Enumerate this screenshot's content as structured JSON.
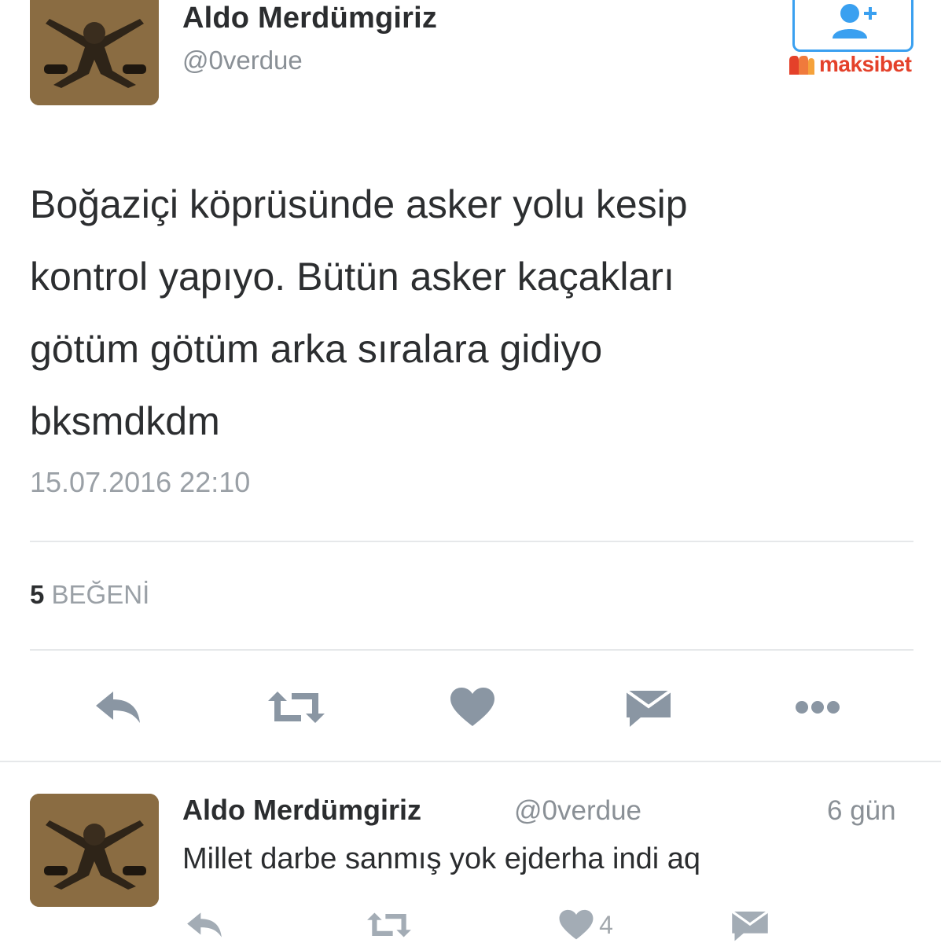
{
  "tweet": {
    "author_name": "Aldo Merdümgiriz",
    "author_handle": "@0verdue",
    "text_lines": [
      "Boğaziçi köprüsünde asker yolu kesip",
      "kontrol yapıyo. Bütün asker kaçakları",
      "götüm götüm arka sıralara gidiyo",
      "bksmdkdm"
    ],
    "timestamp": "15.07.2016 22:10",
    "like_count": "5",
    "like_label": "BEĞENİ",
    "actions": [
      "reply-icon",
      "retweet-icon",
      "like-icon",
      "message-icon",
      "more-icon"
    ]
  },
  "reply": {
    "author_name": "Aldo Merdümgiriz",
    "author_handle": "@0verdue",
    "time": "6 gün",
    "text": "Millet darbe sanmış yok ejderha indi aq",
    "like_count": "4",
    "actions": [
      "reply-icon",
      "retweet-icon",
      "like-icon",
      "message-icon"
    ]
  },
  "watermark": {
    "brand": "maksibet"
  },
  "colors": {
    "follow_border": "#3aa0f0",
    "icon_gray": "#8a96a3",
    "brand_red": "#e4412a"
  }
}
